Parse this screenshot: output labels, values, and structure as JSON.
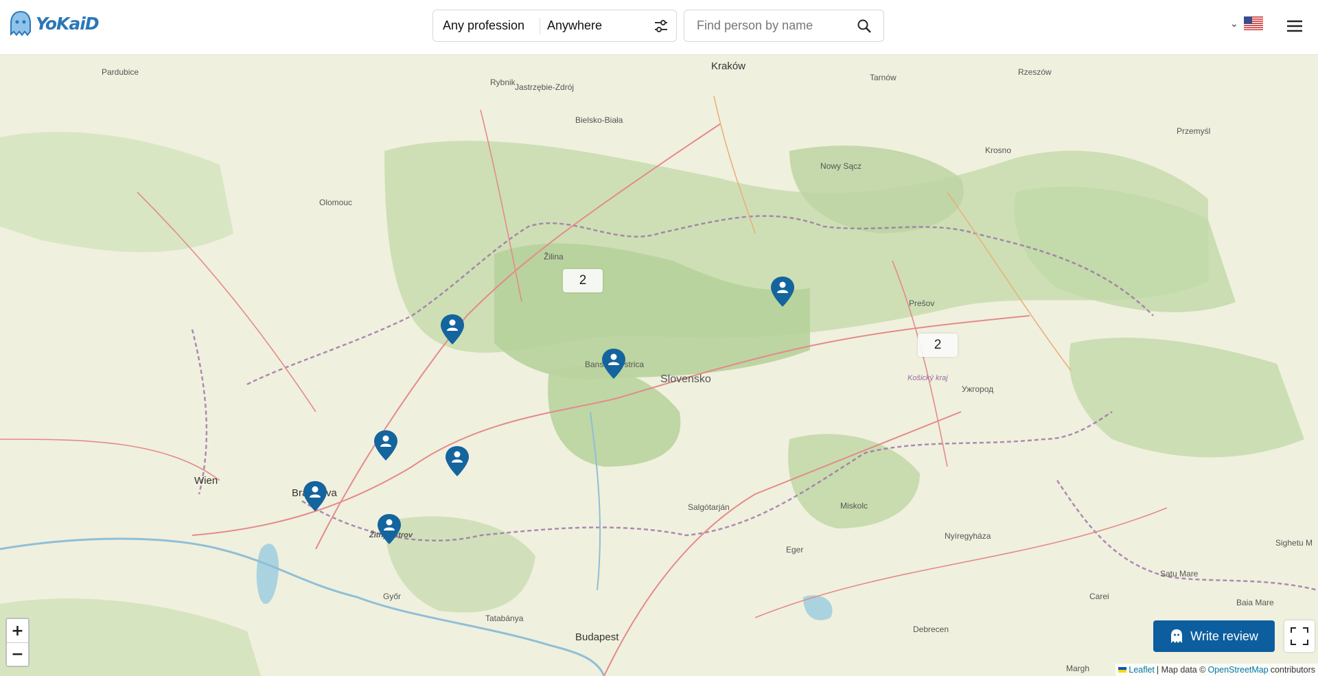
{
  "header": {
    "logo_text": "YoKaiD",
    "profession_filter": "Any profession",
    "location_filter": "Anywhere",
    "search_placeholder": "Find person by name"
  },
  "map": {
    "cities": [
      "Kraków",
      "Wien",
      "Bratislava",
      "Budapest",
      "Banská Bystrica",
      "Žilina",
      "Prešov",
      "Košický kraj",
      "Olomouc",
      "Pardubice",
      "Rybnik",
      "Jastrzębie-Zdrój",
      "Bielsko-Biała",
      "Nowy Sącz",
      "Tarnów",
      "Rzeszów",
      "Przemyśl",
      "Krosno",
      "Miskolc",
      "Salgótarján",
      "Eger",
      "Debrecen",
      "Nyíregyháza",
      "Győr",
      "Tatabánya",
      "Ужгород",
      "Satu Mare",
      "Carei",
      "Baia Mare",
      "Sighetu M",
      "Margh",
      "Žitný ostrov"
    ],
    "country_label": "Slovensko",
    "clusters": [
      "2",
      "2"
    ],
    "markers_count": 8
  },
  "controls": {
    "zoom_in": "+",
    "zoom_out": "−",
    "write_review": "Write review"
  },
  "attribution": {
    "leaflet": "Leaflet",
    "sep": "| Map data ©",
    "osm": "OpenStreetMap",
    "contrib": "contributors"
  }
}
